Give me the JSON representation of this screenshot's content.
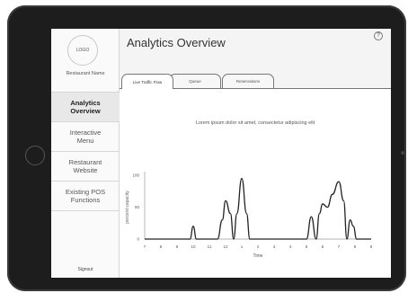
{
  "sidebar": {
    "logo_text": "LOGO",
    "restaurant_name": "Restaurant Name",
    "items": [
      {
        "label": "Analytics\nOverview",
        "active": true
      },
      {
        "label": "Interactive\nMenu",
        "active": false
      },
      {
        "label": "Restaurant\nWebsite",
        "active": false
      },
      {
        "label": "Existing POS\nFunctions",
        "active": false
      }
    ],
    "signout_label": "Signout"
  },
  "header": {
    "title": "Analytics Overview",
    "help_icon": "?"
  },
  "tabs": [
    {
      "label": "Live Traffic Flow",
      "active": true
    },
    {
      "label": "Queue",
      "active": false
    },
    {
      "label": "Reservations",
      "active": false
    }
  ],
  "chart_data": {
    "type": "line",
    "title": "Lorem ipsum dolor sit amet, consectetur adipiscing elit",
    "xlabel": "Time",
    "ylabel": "percent capacity",
    "y_ticks": [
      0,
      50,
      100
    ],
    "ylim": [
      0,
      100
    ],
    "x_tick_labels": [
      "7",
      "8",
      "9",
      "10",
      "11",
      "12",
      "1",
      "2",
      "3",
      "4",
      "5",
      "6",
      "7",
      "8",
      "9"
    ],
    "series": [
      {
        "values": [
          [
            7,
            0
          ],
          [
            9.8,
            0
          ],
          [
            10,
            20
          ],
          [
            10.2,
            0
          ],
          [
            11.5,
            0
          ],
          [
            11.8,
            30
          ],
          [
            12,
            60
          ],
          [
            12.3,
            40
          ],
          [
            12.5,
            0
          ],
          [
            12.7,
            40
          ],
          [
            13,
            95
          ],
          [
            13.3,
            40
          ],
          [
            13.5,
            0
          ],
          [
            17,
            0
          ],
          [
            17.3,
            35
          ],
          [
            17.6,
            0
          ],
          [
            17.8,
            40
          ],
          [
            18,
            55
          ],
          [
            18.3,
            50
          ],
          [
            18.6,
            70
          ],
          [
            19,
            90
          ],
          [
            19.3,
            60
          ],
          [
            19.5,
            0
          ],
          [
            19.7,
            30
          ],
          [
            19.9,
            20
          ],
          [
            20.1,
            0
          ],
          [
            21,
            0
          ]
        ]
      }
    ],
    "grid": false,
    "line_color": "#222222"
  }
}
